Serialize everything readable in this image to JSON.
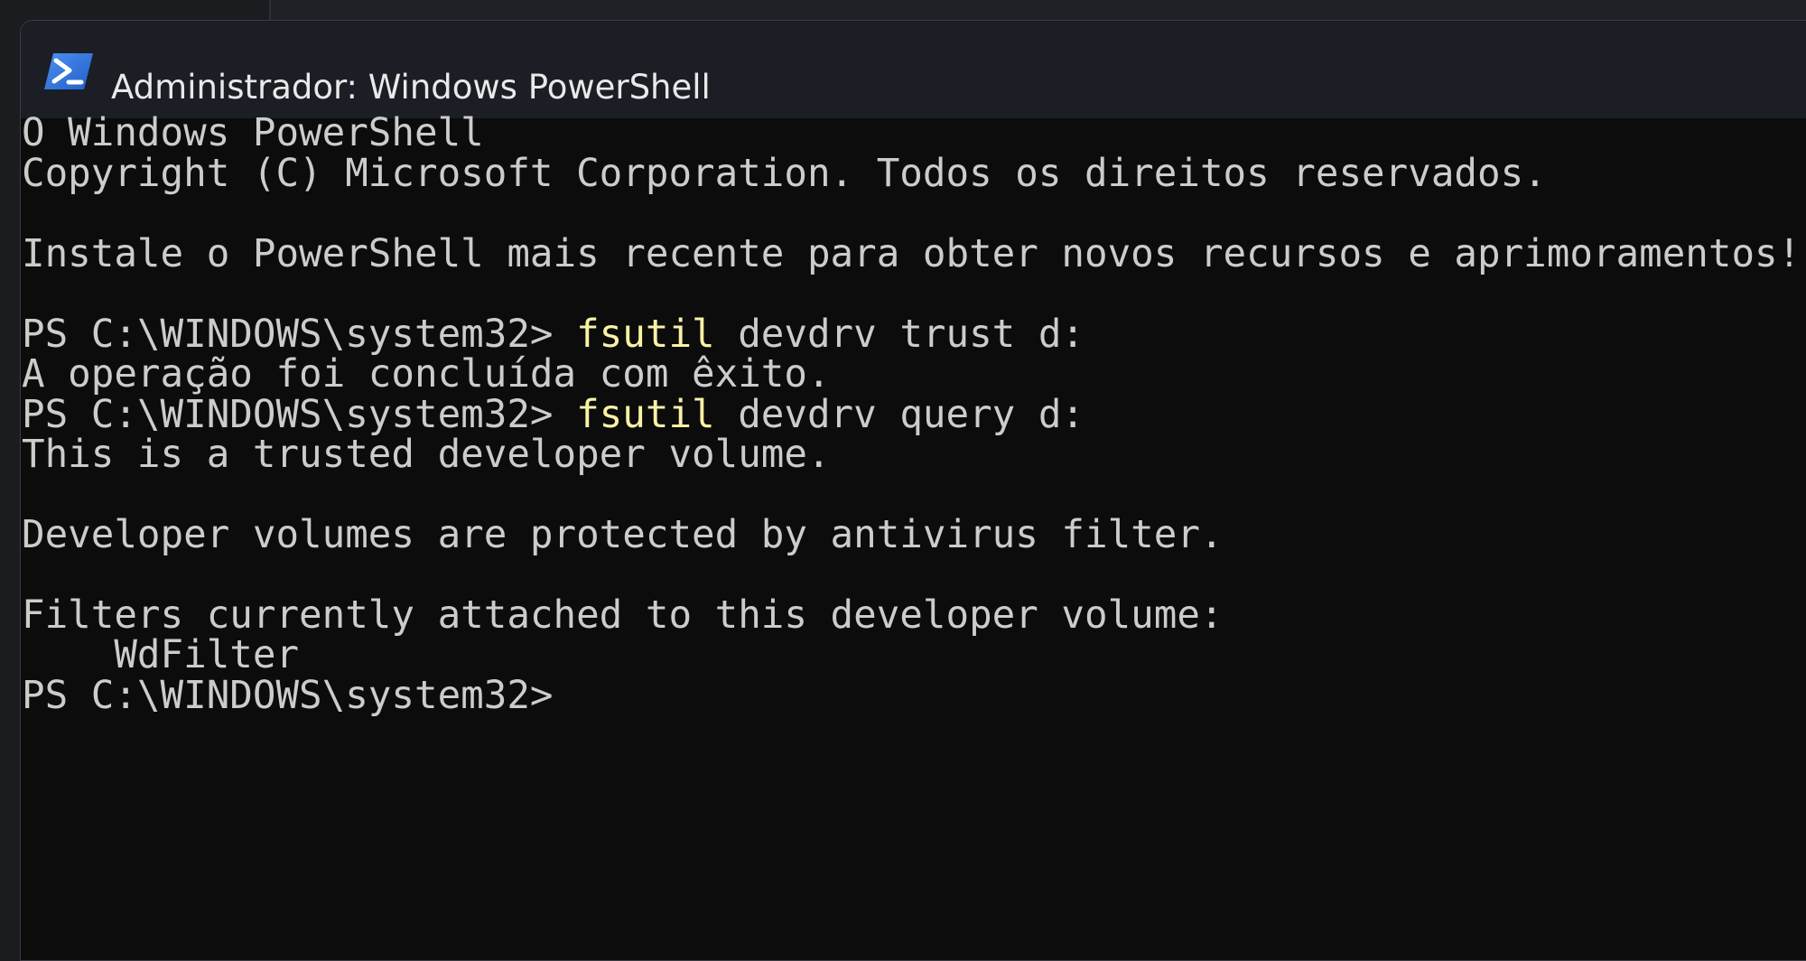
{
  "window": {
    "title": "Administrador: Windows PowerShell",
    "icon": "powershell-icon"
  },
  "colors": {
    "terminal_bg": "#0c0c0c",
    "terminal_text": "#cccccc",
    "command_highlight": "#f9f1a5",
    "titlebar_bg": "#1b1e24",
    "icon_blue": "#2e6fd6"
  },
  "terminal": {
    "banner_1": "O Windows PowerShell",
    "banner_2": "Copyright (C) Microsoft Corporation. Todos os direitos reservados.",
    "banner_3": "Instale o PowerShell mais recente para obter novos recursos e aprimoramentos! ",
    "prompt": "PS C:\\WINDOWS\\system32> ",
    "command_1": {
      "name": "fsutil",
      "args": " devdrv trust d:"
    },
    "output_1": "A operação foi concluída com êxito.",
    "command_2": {
      "name": "fsutil",
      "args": " devdrv query d:"
    },
    "output_2": "This is a trusted developer volume.",
    "output_3": "Developer volumes are protected by antivirus filter.",
    "output_4": "Filters currently attached to this developer volume:",
    "output_5": "    WdFilter",
    "final_prompt": "PS C:\\WINDOWS\\system32>"
  }
}
